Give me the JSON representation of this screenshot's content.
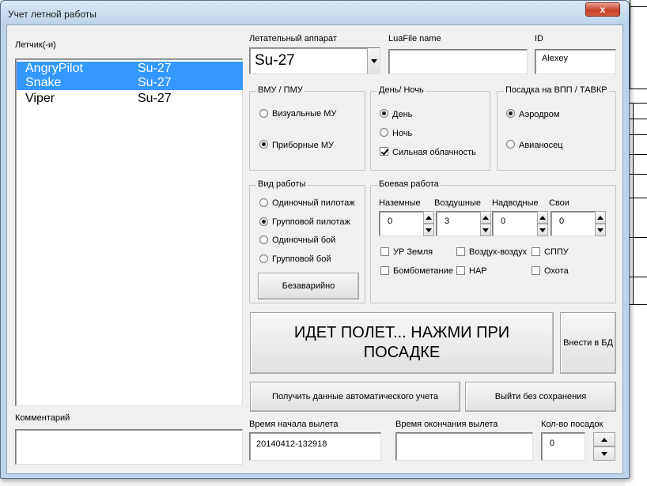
{
  "window": {
    "title": "Учет летной работы",
    "close_symbol": "x"
  },
  "pilots": {
    "label": "Летчик(-и)",
    "items": [
      {
        "name": "AngryPilot",
        "aircraft": "Su-27",
        "selected": true
      },
      {
        "name": "Snake",
        "aircraft": "Su-27",
        "selected": true
      },
      {
        "name": "Viper",
        "aircraft": "Su-27",
        "selected": false
      }
    ]
  },
  "comment": {
    "label": "Комментарий",
    "value": ""
  },
  "aircraft": {
    "label": "Летательный аппарат",
    "value": "Su-27"
  },
  "luafile": {
    "label": "LuaFile name",
    "value": ""
  },
  "id_field": {
    "label": "ID",
    "value": "Alexey"
  },
  "vmu": {
    "caption": "ВМУ / ПМУ",
    "options": [
      {
        "label": "Визуальные МУ",
        "checked": false
      },
      {
        "label": "Приборные МУ",
        "checked": true
      }
    ]
  },
  "daynight": {
    "caption": "День/ Ночь",
    "options": [
      {
        "label": "День",
        "checked": true
      },
      {
        "label": "Ночь",
        "checked": false
      }
    ],
    "cloud": {
      "label": "Сильная облачность",
      "checked": true
    }
  },
  "landing": {
    "caption": "Посадка на ВПП / ТАВКР",
    "options": [
      {
        "label": "Аэродром",
        "checked": true
      },
      {
        "label": "Авианосец",
        "checked": false
      }
    ]
  },
  "worktype": {
    "caption": "Вид работы",
    "options": [
      {
        "label": "Одиночный пилотаж",
        "checked": false
      },
      {
        "label": "Групповой пилотаж",
        "checked": true
      },
      {
        "label": "Одиночный бой",
        "checked": false
      },
      {
        "label": "Групповой бой",
        "checked": false
      }
    ],
    "safe_button": "Безаварийно"
  },
  "combat": {
    "caption": "Боевая работа",
    "counters": [
      {
        "label": "Наземные",
        "value": "0"
      },
      {
        "label": "Воздушные",
        "value": "3"
      },
      {
        "label": "Надводные",
        "value": "0"
      },
      {
        "label": "Свои",
        "value": "0"
      }
    ],
    "checks": [
      {
        "label": "УР Земля",
        "checked": false
      },
      {
        "label": "Воздух-воздух",
        "checked": false
      },
      {
        "label": "СППУ",
        "checked": false
      },
      {
        "label": "Бомбометание",
        "checked": false
      },
      {
        "label": "НАР",
        "checked": false
      },
      {
        "label": "Охота",
        "checked": false
      }
    ]
  },
  "flight_status": {
    "line1": "ИДЕТ ПОЛЕТ... НАЖМИ ПРИ",
    "line2": "ПОСАДКЕ"
  },
  "buttons": {
    "submit": "Внести в БД",
    "auto_data": "Получить данные автоматического учета",
    "exit": "Выйти без сохранения"
  },
  "times": {
    "start_label": "Время начала вылета",
    "start_value": "20140412-132918",
    "end_label": "Время окончания вылета",
    "end_value": ""
  },
  "landings": {
    "label": "Кол-во посадок",
    "value": "0"
  }
}
